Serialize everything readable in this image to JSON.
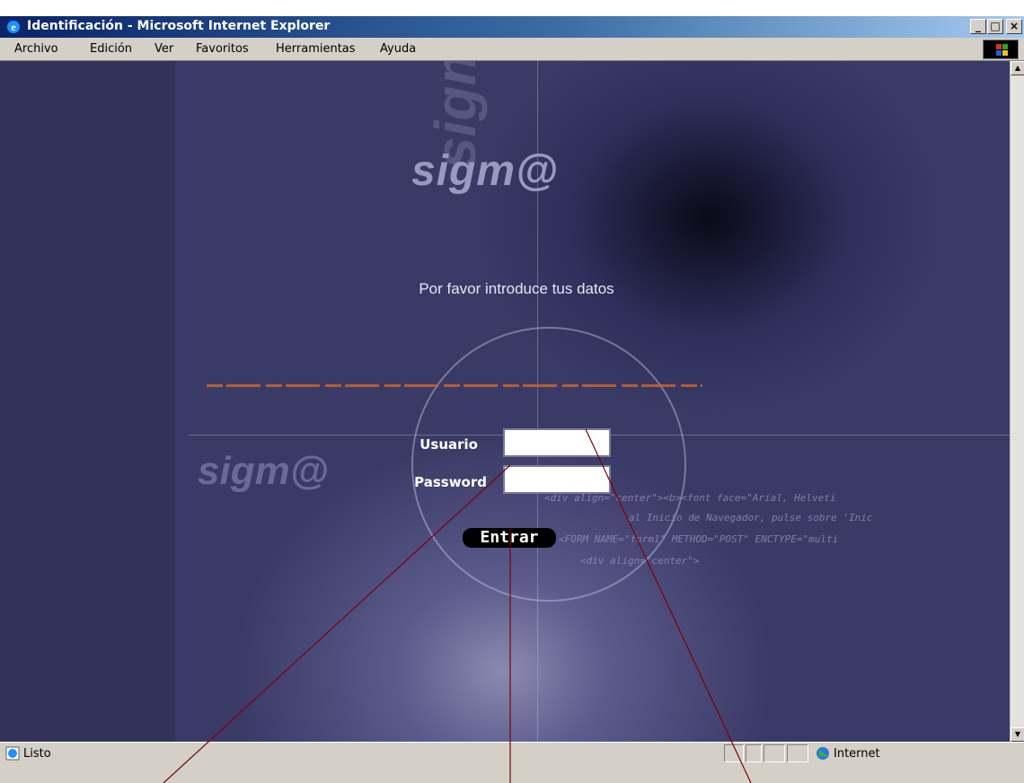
{
  "window": {
    "title": "Identificación - Microsoft Internet Explorer",
    "minimize": "_",
    "maximize": "□",
    "close": "×"
  },
  "menu": {
    "items": [
      {
        "label": "Archivo"
      },
      {
        "label": "Edición"
      },
      {
        "label": "Ver"
      },
      {
        "label": "Favoritos"
      },
      {
        "label": "Herramientas"
      },
      {
        "label": "Ayuda"
      }
    ]
  },
  "page": {
    "logo": "sigm@",
    "logo_small": "sigm@",
    "prompt": "Por favor introduce tus datos",
    "code_lines": [
      "<div align=\"center\"><b><font face=\"Arial, Helveti",
      "al Inicio de Navegador, pulse sobre 'Inic",
      "<FORM NAME=\"form1\" METHOD=\"POST\" ENCTYPE=\"multi",
      "<div align=\"center\">"
    ]
  },
  "form": {
    "username_label": "Usuario",
    "username_value": "",
    "password_label": "Password",
    "password_value": "",
    "submit_label": "Entrar"
  },
  "status": {
    "text": "Listo",
    "zone": "Internet"
  },
  "colors": {
    "titlebar_start": "#0a246a",
    "titlebar_end": "#a6caf0",
    "chrome": "#d4d0c8",
    "page_bg": "#3a3a66",
    "annotation": "#800000"
  }
}
